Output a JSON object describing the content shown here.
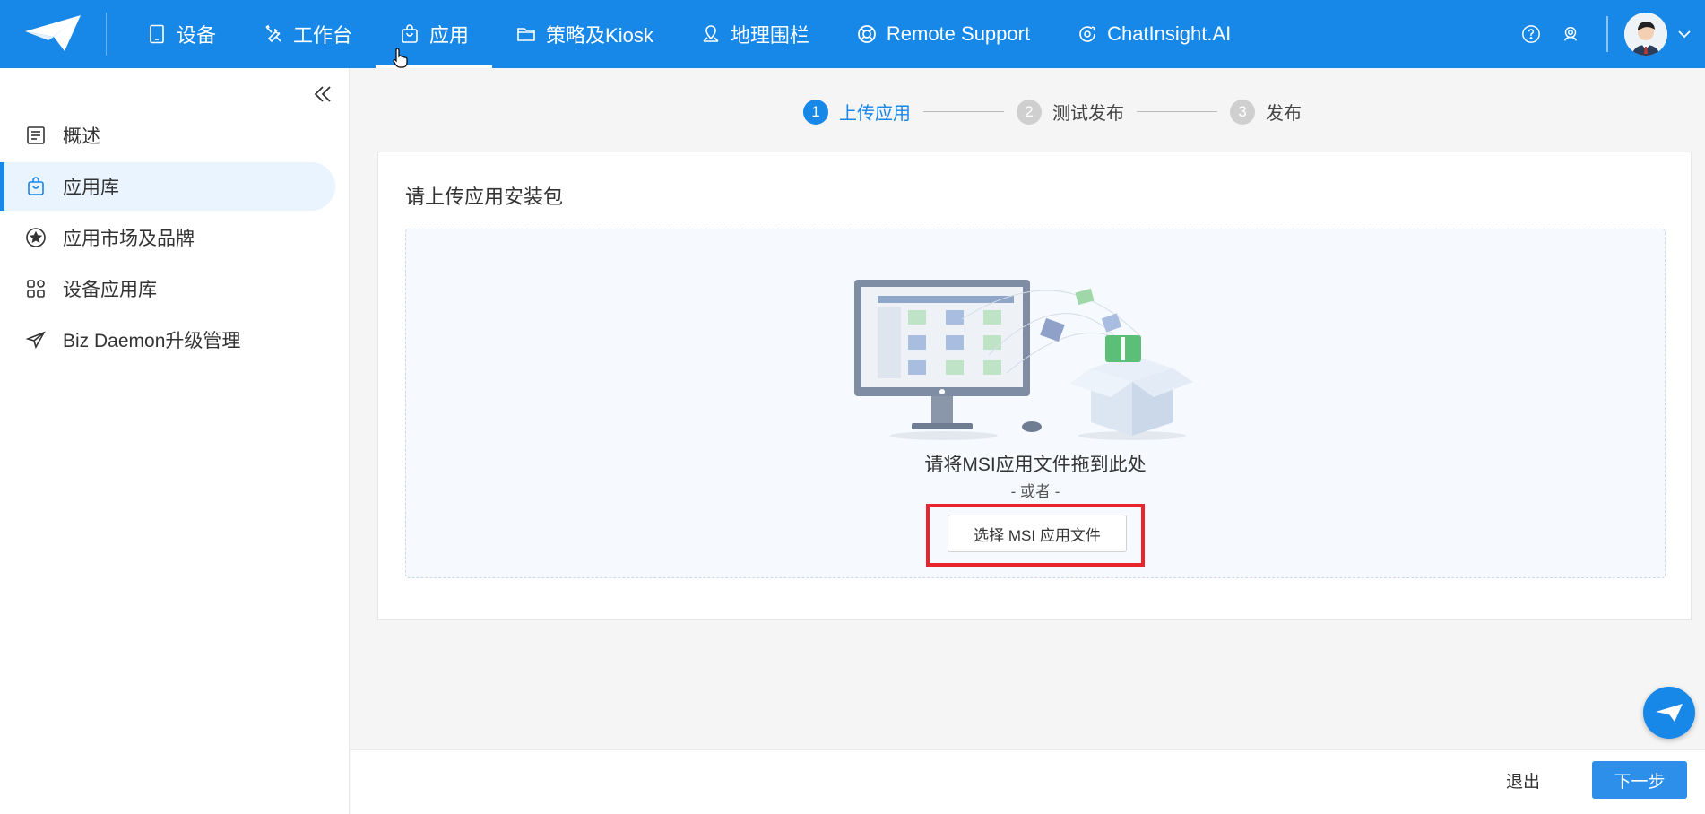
{
  "nav": {
    "items": [
      {
        "label": "设备",
        "icon": "tablet-icon"
      },
      {
        "label": "工作台",
        "icon": "tools-icon"
      },
      {
        "label": "应用",
        "icon": "bag-icon",
        "active": true
      },
      {
        "label": "策略及Kiosk",
        "icon": "folder-icon"
      },
      {
        "label": "地理围栏",
        "icon": "map-icon"
      },
      {
        "label": "Remote Support",
        "icon": "lifebuoy-icon"
      },
      {
        "label": "ChatInsight.AI",
        "icon": "ai-chat-icon"
      }
    ],
    "right_icons": [
      "help-icon",
      "support-agent-icon"
    ]
  },
  "sidebar": {
    "items": [
      {
        "label": "概述",
        "icon": "overview-icon"
      },
      {
        "label": "应用库",
        "icon": "bag-icon",
        "active": true
      },
      {
        "label": "应用市场及品牌",
        "icon": "star-circle-icon"
      },
      {
        "label": "设备应用库",
        "icon": "apps-grid-icon"
      },
      {
        "label": "Biz Daemon升级管理",
        "icon": "send-icon"
      }
    ]
  },
  "steps": [
    {
      "num": "1",
      "label": "上传应用",
      "active": true
    },
    {
      "num": "2",
      "label": "测试发布"
    },
    {
      "num": "3",
      "label": "发布"
    }
  ],
  "upload": {
    "title": "请上传应用安装包",
    "drop_text": "请将MSI应用文件拖到此处",
    "or_text": "- 或者 -",
    "choose_button": "选择 MSI 应用文件"
  },
  "footer": {
    "exit": "退出",
    "next": "下一步"
  },
  "colors": {
    "primary": "#1787e8",
    "highlight": "#e8242c"
  }
}
